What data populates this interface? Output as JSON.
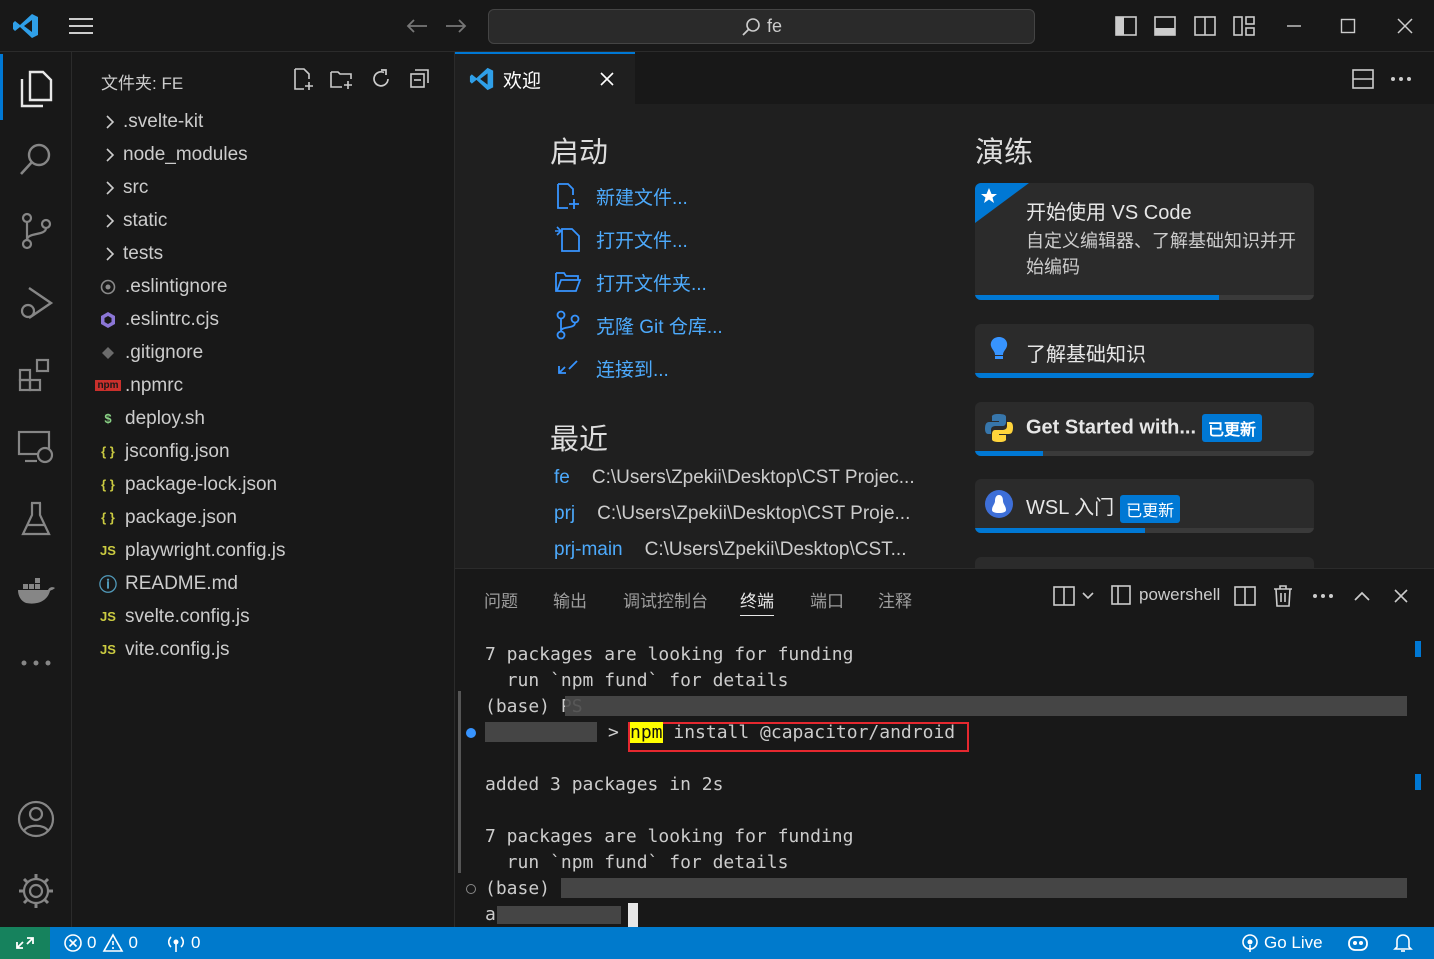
{
  "titlebar": {
    "search_text": "fe",
    "icons": [
      "vscode-logo",
      "menu-icon",
      "back-arrow-icon",
      "forward-arrow-icon",
      "search-icon",
      "toggle-primary-sidebar-icon",
      "toggle-panel-icon",
      "toggle-secondary-sidebar-icon",
      "customize-layout-icon",
      "minimize-icon",
      "maximize-icon",
      "close-icon"
    ]
  },
  "activitybar": {
    "icons": [
      "explorer-icon",
      "search-icon",
      "source-control-icon",
      "run-debug-icon",
      "extensions-icon",
      "remote-explorer-icon",
      "testing-icon",
      "docker-icon",
      "more-icon",
      "account-icon",
      "manage-gear-icon"
    ]
  },
  "explorer": {
    "title": "文件夹: FE",
    "items": [
      {
        "label": ".svelte-kit",
        "type": "folder"
      },
      {
        "label": "node_modules",
        "type": "folder"
      },
      {
        "label": "src",
        "type": "folder"
      },
      {
        "label": "static",
        "type": "folder"
      },
      {
        "label": "tests",
        "type": "folder"
      },
      {
        "label": ".eslintignore",
        "type": "file",
        "icon": "eslintignore-icon"
      },
      {
        "label": ".eslintrc.cjs",
        "type": "file",
        "icon": "eslint-icon"
      },
      {
        "label": ".gitignore",
        "type": "file",
        "icon": "git-icon"
      },
      {
        "label": ".npmrc",
        "type": "file",
        "icon": "npm-icon",
        "glyph": "npm"
      },
      {
        "label": "deploy.sh",
        "type": "file",
        "icon": "shell-icon",
        "glyph": "$"
      },
      {
        "label": "jsconfig.json",
        "type": "file",
        "icon": "json-icon",
        "glyph": "{ }"
      },
      {
        "label": "package-lock.json",
        "type": "file",
        "icon": "json-icon",
        "glyph": "{ }"
      },
      {
        "label": "package.json",
        "type": "file",
        "icon": "json-icon",
        "glyph": "{ }"
      },
      {
        "label": "playwright.config.js",
        "type": "file",
        "icon": "js-icon",
        "glyph": "JS"
      },
      {
        "label": "README.md",
        "type": "file",
        "icon": "info-icon",
        "glyph": "ⓘ"
      },
      {
        "label": "svelte.config.js",
        "type": "file",
        "icon": "js-icon",
        "glyph": "JS"
      },
      {
        "label": "vite.config.js",
        "type": "file",
        "icon": "js-icon",
        "glyph": "JS"
      }
    ]
  },
  "editor": {
    "tab_label": "欢迎",
    "start_heading": "启动",
    "start_items": [
      {
        "label": "新建文件...",
        "icon": "new-file-icon"
      },
      {
        "label": "打开文件...",
        "icon": "open-file-icon"
      },
      {
        "label": "打开文件夹...",
        "icon": "open-folder-icon"
      },
      {
        "label": "克隆 Git 仓库...",
        "icon": "git-clone-icon"
      },
      {
        "label": "连接到...",
        "icon": "remote-connect-icon"
      }
    ],
    "recent_heading": "最近",
    "recent_items": [
      {
        "name": "fe",
        "path": "C:\\Users\\Zpekii\\Desktop\\CST Projec..."
      },
      {
        "name": "prj",
        "path": "C:\\Users\\Zpekii\\Desktop\\CST Proje..."
      },
      {
        "name": "prj-main",
        "path": "C:\\Users\\Zpekii\\Desktop\\CST..."
      }
    ],
    "walkthrough_heading": "演练",
    "walkthroughs": [
      {
        "title": "开始使用 VS Code",
        "desc": "自定义编辑器、了解基础知识并开始编码",
        "progress": 0.72,
        "badge": ""
      },
      {
        "title": "了解基础知识",
        "desc": "",
        "progress": 1.0,
        "badge": ""
      },
      {
        "title": "Get Started with...",
        "desc": "",
        "progress": 0.2,
        "badge": "已更新"
      },
      {
        "title": "WSL 入门",
        "desc": "",
        "progress": 0.5,
        "badge": "已更新"
      }
    ]
  },
  "panel": {
    "tabs": [
      "问题",
      "输出",
      "调试控制台",
      "终端",
      "端口",
      "注释"
    ],
    "active_tab": "终端",
    "shell_label": "powershell",
    "terminal_lines": [
      "7 packages are looking for funding",
      "  run `npm fund` for details",
      "(base) PS",
      "npm install @capacitor/android",
      "added 3 packages in 2s",
      "7 packages are looking for funding",
      "  run `npm fund` for details",
      "(base)",
      "a"
    ],
    "command_highlight": "npm",
    "command_rest": " install @capacitor/android"
  },
  "statusbar": {
    "errors": "0",
    "warnings": "0",
    "ports": "0",
    "go_live": "Go Live"
  }
}
